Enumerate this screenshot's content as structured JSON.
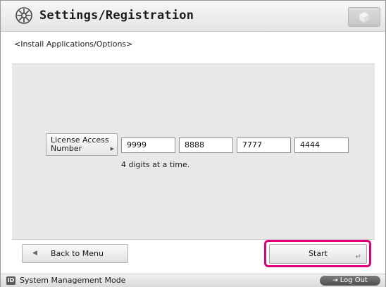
{
  "header": {
    "title": "Settings/Registration",
    "icon": "settings-gear-icon",
    "corner_button_icon": "cube-icon"
  },
  "subtitle": "<Install Applications/Options>",
  "license": {
    "label": "License Access Number",
    "fields": [
      "9999",
      "8888",
      "7777",
      "4444"
    ],
    "hint": "4 digits at a time."
  },
  "buttons": {
    "back_label": "Back to Menu",
    "start_label": "Start"
  },
  "status_bar": {
    "badge": "ID",
    "mode": "System Management Mode",
    "logout_label": "Log Out"
  },
  "colors": {
    "highlight": "#e2007a"
  }
}
